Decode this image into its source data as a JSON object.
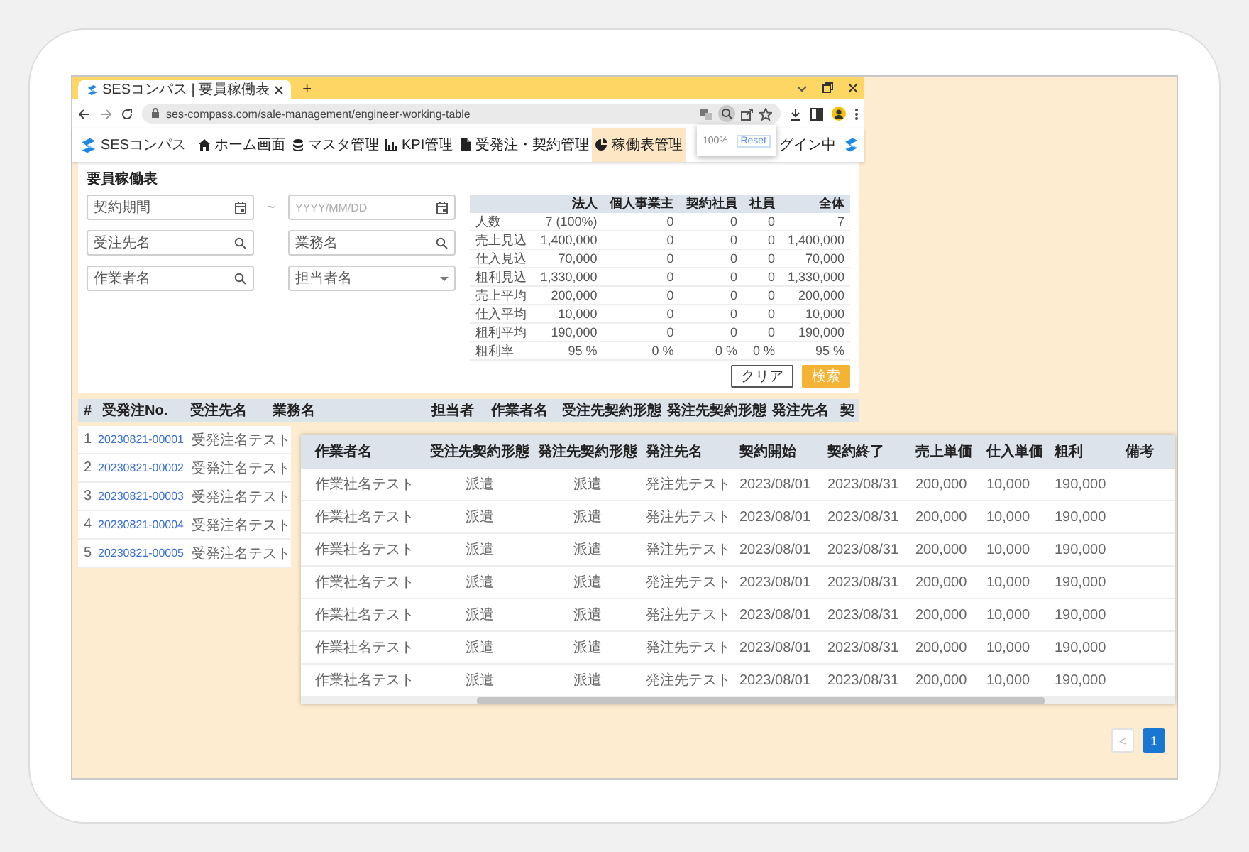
{
  "browser": {
    "tabs": [
      {
        "title": "SESコンパス | 要員稼働表",
        "selected": true
      }
    ],
    "new_tab": "+",
    "address": "ses-compass.com/sale-management/engineer-working-table"
  },
  "zoom_popup": {
    "level_text": "100%",
    "reset": "Reset"
  },
  "app": {
    "logo": "SESコンパス",
    "nav": [
      {
        "label": "ホーム画面",
        "selected": false
      },
      {
        "label": "マスタ管理",
        "selected": false
      },
      {
        "label": "KPI管理",
        "selected": false
      },
      {
        "label": "受発注・契約管理",
        "selected": false
      },
      {
        "label": "稼働表管理",
        "selected": true
      }
    ],
    "user_status": "グイン中"
  },
  "page_title": "要員稼働表",
  "date_range": {
    "from_placeholder": "契約期間",
    "separator": "~",
    "to_placeholder": "YYYY/MM/DD"
  },
  "fields": [
    {
      "kind": "search",
      "placeholder": "受注先名"
    },
    {
      "kind": "search",
      "placeholder": "業務名"
    },
    {
      "kind": "search",
      "placeholder": "作業者名"
    },
    {
      "kind": "select",
      "placeholder": "担当者名"
    }
  ],
  "summary": {
    "columns": [
      "法人",
      "個人事業主",
      "契約社員",
      "社員",
      "全体"
    ],
    "rows": [
      {
        "label": "人数",
        "values": [
          "7 (100%)",
          "0",
          "0",
          "0",
          "7"
        ]
      },
      {
        "label": "売上見込",
        "values": [
          "1,400,000",
          "0",
          "0",
          "0",
          "1,400,000"
        ]
      },
      {
        "label": "仕入見込",
        "values": [
          "70,000",
          "0",
          "0",
          "0",
          "70,000"
        ]
      },
      {
        "label": "粗利見込",
        "values": [
          "1,330,000",
          "0",
          "0",
          "0",
          "1,330,000"
        ]
      },
      {
        "label": "売上平均",
        "values": [
          "200,000",
          "0",
          "0",
          "0",
          "200,000"
        ]
      },
      {
        "label": "仕入平均",
        "values": [
          "10,000",
          "0",
          "0",
          "0",
          "10,000"
        ]
      },
      {
        "label": "粗利平均",
        "values": [
          "190,000",
          "0",
          "0",
          "0",
          "190,000"
        ]
      },
      {
        "label": "粗利率",
        "values": [
          "95 %",
          "0 %",
          "0 %",
          "0 %",
          "95 %"
        ]
      }
    ]
  },
  "buttons": [
    {
      "label": "クリア",
      "kind": "secondary"
    },
    {
      "label": "検索",
      "kind": "primary"
    }
  ],
  "list": {
    "columns": [
      "#",
      "受発注No.",
      "受注先名",
      "業務名",
      "担当者",
      "作業者名",
      "受注先契約形態",
      "発注先契約形態",
      "発注先名",
      "契"
    ],
    "rows": [
      {
        "index": "1",
        "number": "20230821-00001",
        "client": "受発注名テスト"
      },
      {
        "index": "2",
        "number": "20230821-00002",
        "client": "受発注名テスト"
      },
      {
        "index": "3",
        "number": "20230821-00003",
        "client": "受発注名テスト"
      },
      {
        "index": "4",
        "number": "20230821-00004",
        "client": "受発注名テスト"
      },
      {
        "index": "5",
        "number": "20230821-00005",
        "client": "受発注名テスト"
      }
    ]
  },
  "detail": {
    "columns": [
      "作業者名",
      "受注先契約形態",
      "発注先契約形態",
      "発注先名",
      "契約開始",
      "契約終了",
      "売上単価",
      "仕入単価",
      "粗利",
      "備考"
    ],
    "rows": [
      [
        "作業社名テスト",
        "派遣",
        "派遣",
        "発注先テスト",
        "2023/08/01",
        "2023/08/31",
        "200,000",
        "10,000",
        "190,000"
      ],
      [
        "作業社名テスト",
        "派遣",
        "派遣",
        "発注先テスト",
        "2023/08/01",
        "2023/08/31",
        "200,000",
        "10,000",
        "190,000"
      ],
      [
        "作業社名テスト",
        "派遣",
        "派遣",
        "発注先テスト",
        "2023/08/01",
        "2023/08/31",
        "200,000",
        "10,000",
        "190,000"
      ],
      [
        "作業社名テスト",
        "派遣",
        "派遣",
        "発注先テスト",
        "2023/08/01",
        "2023/08/31",
        "200,000",
        "10,000",
        "190,000"
      ],
      [
        "作業社名テスト",
        "派遣",
        "派遣",
        "発注先テスト",
        "2023/08/01",
        "2023/08/31",
        "200,000",
        "10,000",
        "190,000"
      ],
      [
        "作業社名テスト",
        "派遣",
        "派遣",
        "発注先テスト",
        "2023/08/01",
        "2023/08/31",
        "200,000",
        "10,000",
        "190,000"
      ],
      [
        "作業社名テスト",
        "派遣",
        "派遣",
        "発注先テスト",
        "2023/08/01",
        "2023/08/31",
        "200,000",
        "10,000",
        "190,000"
      ]
    ]
  },
  "pagination": {
    "previous": {
      "label": "<",
      "disabled": true
    },
    "pages": [
      {
        "label": "1",
        "selected": true
      }
    ]
  }
}
